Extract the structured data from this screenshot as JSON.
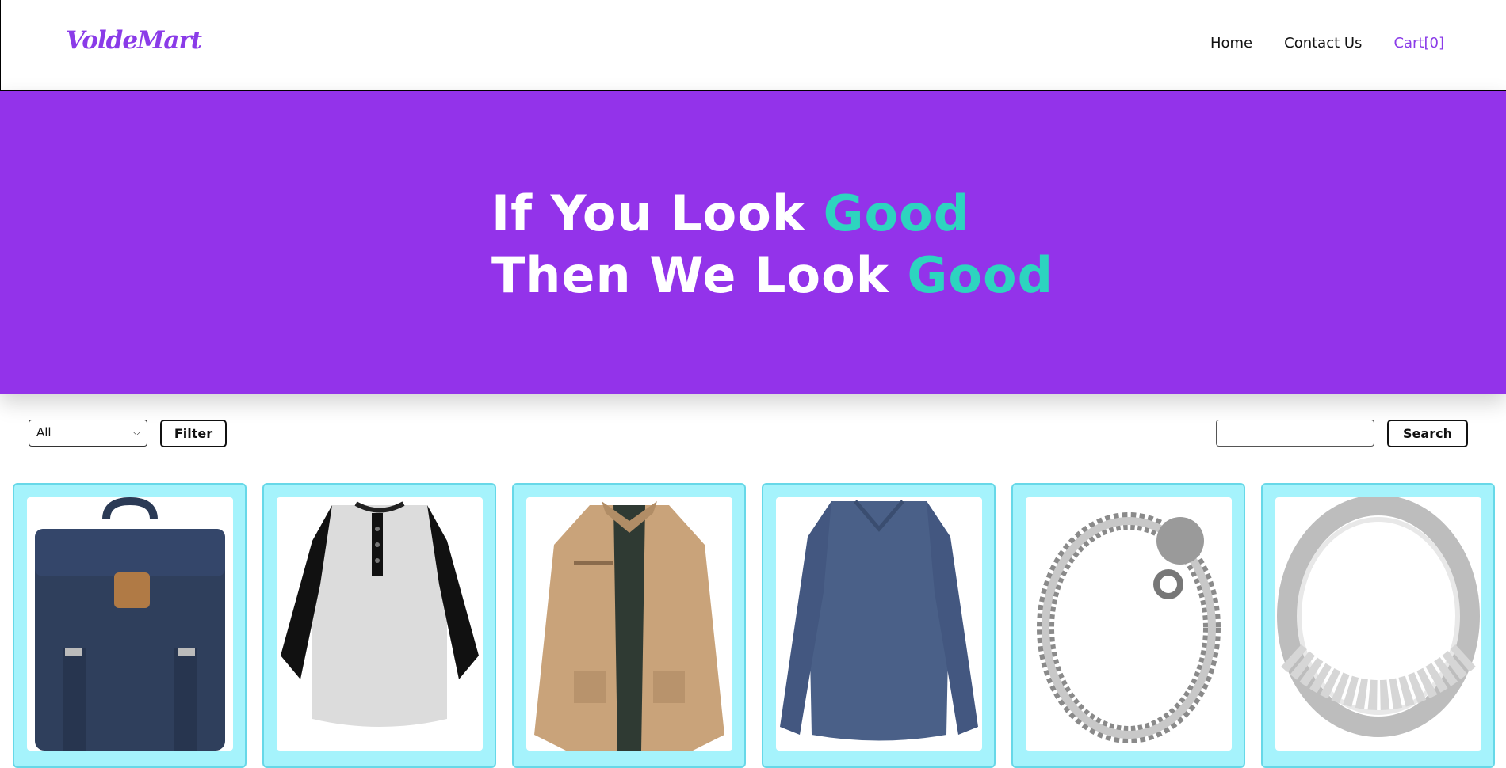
{
  "header": {
    "logo": "VoldeMart",
    "nav": [
      {
        "label": "Home"
      },
      {
        "label": "Contact Us"
      },
      {
        "label": "Cart[0]"
      }
    ]
  },
  "hero": {
    "line1_prefix": "If You Look ",
    "line1_accent": "Good",
    "line2_prefix": "Then We Look ",
    "line2_accent": "Good"
  },
  "controls": {
    "category_selected": "All",
    "filter_label": "Filter",
    "search_value": "",
    "search_label": "Search"
  },
  "products": [
    {
      "icon": "backpack-image"
    },
    {
      "icon": "raglan-tshirt-image"
    },
    {
      "icon": "jacket-image"
    },
    {
      "icon": "longsleeve-shirt-image"
    },
    {
      "icon": "bracelet-image"
    },
    {
      "icon": "ring-image"
    }
  ],
  "colors": {
    "brand": "#9333ea",
    "accent": "#2dd4bf",
    "card": "#a5f3fc"
  }
}
